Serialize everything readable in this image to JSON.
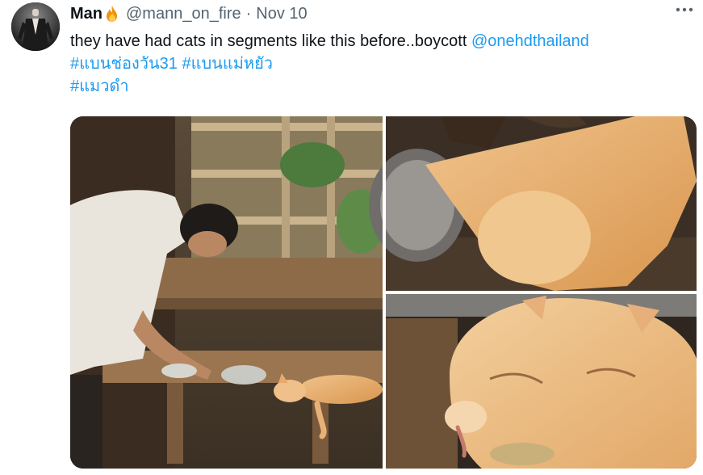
{
  "author": {
    "display_name": "Man",
    "handle": "@mann_on_fire",
    "separator": "·",
    "date": "Nov 10"
  },
  "icons": {
    "name_emoji": "fire-icon",
    "more": "more-horizontal-icon"
  },
  "tweet": {
    "text": "they have had cats in segments like this before..boycott ",
    "mention": "@onehdthailand",
    "hashtags": [
      "#แบนช่องวัน31",
      "#แบนแม่หยัว",
      "#แมวดำ"
    ]
  },
  "colors": {
    "text": "#0f1419",
    "secondary": "#536471",
    "link": "#1d9bf0"
  }
}
